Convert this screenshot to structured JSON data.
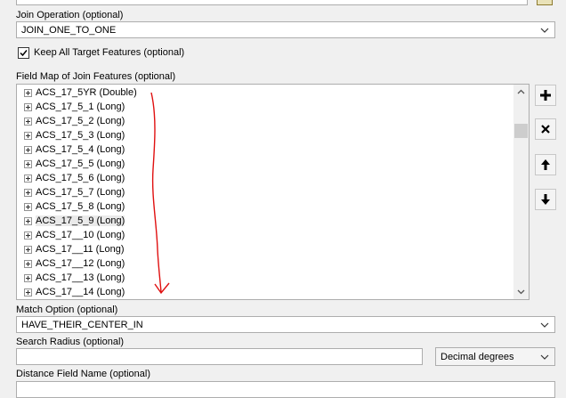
{
  "join_operation": {
    "label": "Join Operation (optional)",
    "value": "JOIN_ONE_TO_ONE"
  },
  "keep_all": {
    "label": "Keep All Target Features (optional)",
    "checked": true
  },
  "field_map": {
    "label": "Field Map of Join Features (optional)",
    "items": [
      "ACS_17_5YR (Double)",
      "ACS_17_5_1 (Long)",
      "ACS_17_5_2 (Long)",
      "ACS_17_5_3 (Long)",
      "ACS_17_5_4 (Long)",
      "ACS_17_5_5 (Long)",
      "ACS_17_5_6 (Long)",
      "ACS_17_5_7 (Long)",
      "ACS_17_5_8 (Long)",
      "ACS_17_5_9 (Long)",
      "ACS_17__10 (Long)",
      "ACS_17__11 (Long)",
      "ACS_17__12 (Long)",
      "ACS_17__13 (Long)",
      "ACS_17__14 (Long)"
    ],
    "selected_index": 9
  },
  "side_buttons": {
    "add_icon": "plus-icon",
    "remove_icon": "x-icon",
    "up_icon": "arrow-up-icon",
    "down_icon": "arrow-down-icon"
  },
  "match_option": {
    "label": "Match Option (optional)",
    "value": "HAVE_THEIR_CENTER_IN"
  },
  "search_radius": {
    "label": "Search Radius (optional)",
    "value": "",
    "unit": "Decimal degrees"
  },
  "distance_field": {
    "label": "Distance Field Name (optional)",
    "value": ""
  },
  "colors": {
    "annotation": "#e01010",
    "border": "#adadad"
  }
}
